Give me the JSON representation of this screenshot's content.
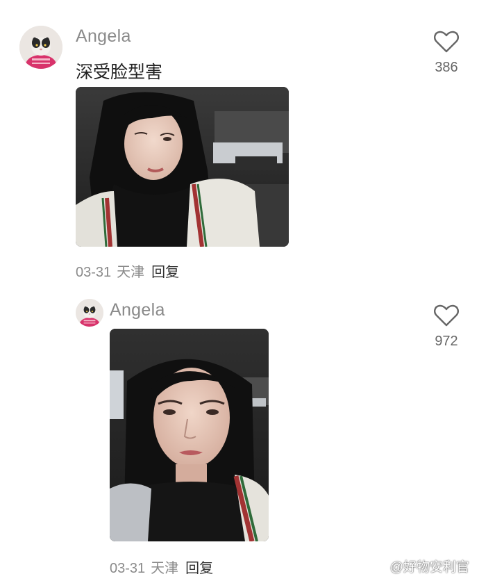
{
  "comments": [
    {
      "username": "Angela",
      "text": "深受脸型害",
      "date": "03-31",
      "location": "天津",
      "reply_label": "回复",
      "likes": "386",
      "avatar_icon": "cat-in-pink-sweater-avatar"
    },
    {
      "username": "Angela",
      "text": "",
      "date": "03-31",
      "location": "天津",
      "reply_label": "回复",
      "likes": "972",
      "avatar_icon": "cat-in-pink-sweater-avatar"
    }
  ],
  "watermark": {
    "icon": "weibo-logo-icon",
    "text": "@好物安利官"
  },
  "colors": {
    "username": "#8a8a8a",
    "text": "#222222",
    "meta": "#8a8a8a",
    "reply": "#333333",
    "heart_outline": "#666666"
  }
}
